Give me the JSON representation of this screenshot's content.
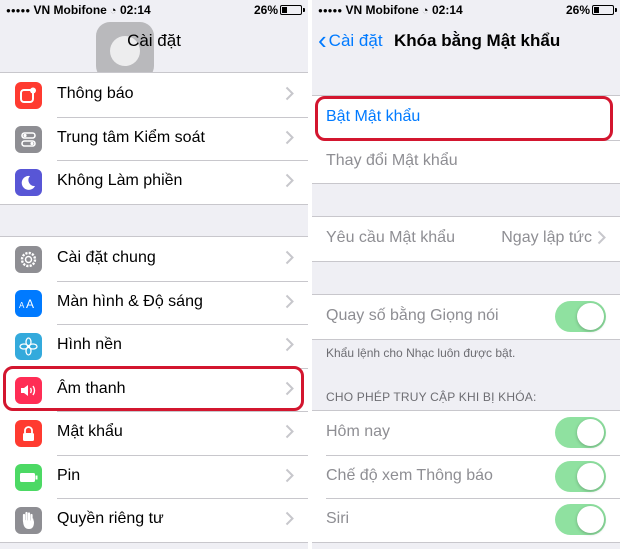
{
  "colors": {
    "accent": "#007aff",
    "highlight": "#d3162f",
    "toggle_on": "#8fe1a0"
  },
  "left": {
    "status": {
      "carrier": "VN Mobifone",
      "time": "02:14",
      "battery": "26%"
    },
    "nav": {
      "title": "Cài đặt"
    },
    "group1": [
      {
        "label": "Thông báo",
        "icon": "notifications-icon",
        "color": "#ff3b30"
      },
      {
        "label": "Trung tâm Kiểm soát",
        "icon": "control-center-icon",
        "color": "#8e8e93"
      },
      {
        "label": "Không Làm phiền",
        "icon": "moon-icon",
        "color": "#5856d6"
      }
    ],
    "group2": [
      {
        "label": "Cài đặt chung",
        "icon": "gear-icon",
        "color": "#8e8e93"
      },
      {
        "label": "Màn hình & Độ sáng",
        "icon": "display-brightness-icon",
        "color": "#007aff"
      },
      {
        "label": "Hình nền",
        "icon": "wallpaper-icon",
        "color": "#34aadc"
      },
      {
        "label": "Âm thanh",
        "icon": "speaker-icon",
        "color": "#ff2d55"
      },
      {
        "label": "Mật khẩu",
        "icon": "lock-icon",
        "color": "#ff3b30"
      },
      {
        "label": "Pin",
        "icon": "battery-icon",
        "color": "#4cd964"
      },
      {
        "label": "Quyền riêng tư",
        "icon": "hand-icon",
        "color": "#8e8e93"
      }
    ]
  },
  "right": {
    "status": {
      "carrier": "VN Mobifone",
      "time": "02:14",
      "battery": "26%"
    },
    "nav": {
      "back": "Cài đặt",
      "title": "Khóa bằng Mật khẩu"
    },
    "passcode_group": [
      {
        "label": "Bật Mật khẩu"
      },
      {
        "label": "Thay đổi Mật khẩu"
      }
    ],
    "require": {
      "label": "Yêu cầu Mật khẩu",
      "value": "Ngay lập tức"
    },
    "voice_dial": {
      "label": "Quay số bằng Giọng nói",
      "on": true
    },
    "voice_footnote": "Khẩu lệnh cho Nhạc luôn được bật.",
    "locked_header": "CHO PHÉP TRUY CẬP KHI BỊ KHÓA:",
    "locked_items": [
      {
        "label": "Hôm nay",
        "on": true
      },
      {
        "label": "Chế độ xem Thông báo",
        "on": true
      },
      {
        "label": "Siri",
        "on": true
      }
    ]
  }
}
